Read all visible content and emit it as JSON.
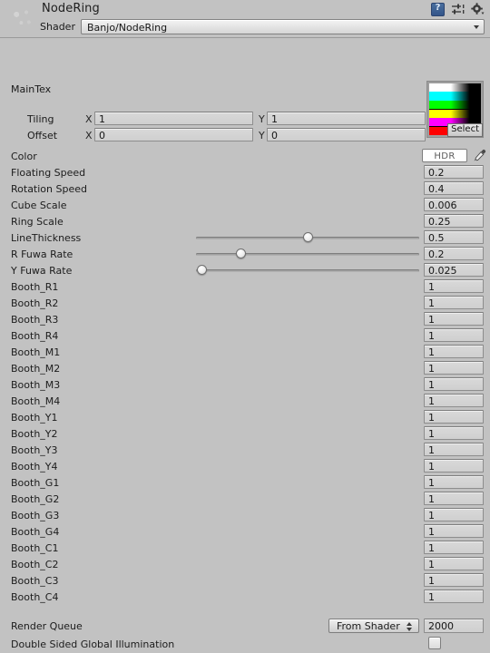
{
  "window": {
    "title": "NodeRing",
    "material_icon_name": "material-sphere-icon"
  },
  "header": {
    "icons": [
      {
        "name": "help-icon",
        "label": "?"
      },
      {
        "name": "preset-icon",
        "label": ""
      },
      {
        "name": "gear-icon",
        "label": ""
      }
    ],
    "shader": {
      "label": "Shader",
      "value": "Banjo/NodeRing"
    }
  },
  "main_texture": {
    "label": "MainTex",
    "select_button": "Select",
    "preview_bars": [
      "#ffffff",
      "#00ffff",
      "#00ff00",
      "#ffff00",
      "#ff00ff",
      "#ff0000"
    ],
    "tiling": {
      "label": "Tiling",
      "x_axis": "X",
      "x_value": "1",
      "y_axis": "Y",
      "y_value": "1"
    },
    "offset": {
      "label": "Offset",
      "x_axis": "X",
      "x_value": "0",
      "y_axis": "Y",
      "y_value": "0"
    }
  },
  "color_property": {
    "label": "Color",
    "hdr_label": "HDR",
    "swatch_color": "#ffffff",
    "eyedropper_name": "eyedropper-icon"
  },
  "properties": [
    {
      "label": "Floating Speed",
      "value": "0.2",
      "type": "number"
    },
    {
      "label": "Rotation Speed",
      "value": "0.4",
      "type": "number"
    },
    {
      "label": "Cube Scale",
      "value": "0.006",
      "type": "number"
    },
    {
      "label": "Ring Scale",
      "value": "0.25",
      "type": "number"
    },
    {
      "label": "LineThickness",
      "value": "0.5",
      "type": "slider",
      "fraction": 0.5
    },
    {
      "label": "R Fuwa Rate",
      "value": "0.2",
      "type": "slider",
      "fraction": 0.2
    },
    {
      "label": "Y Fuwa Rate",
      "value": "0.025",
      "type": "slider",
      "fraction": 0.025
    },
    {
      "label": "Booth_R1",
      "value": "1",
      "type": "number"
    },
    {
      "label": "Booth_R2",
      "value": "1",
      "type": "number"
    },
    {
      "label": "Booth_R3",
      "value": "1",
      "type": "number"
    },
    {
      "label": "Booth_R4",
      "value": "1",
      "type": "number"
    },
    {
      "label": "Booth_M1",
      "value": "1",
      "type": "number"
    },
    {
      "label": "Booth_M2",
      "value": "1",
      "type": "number"
    },
    {
      "label": "Booth_M3",
      "value": "1",
      "type": "number"
    },
    {
      "label": "Booth_M4",
      "value": "1",
      "type": "number"
    },
    {
      "label": "Booth_Y1",
      "value": "1",
      "type": "number"
    },
    {
      "label": "Booth_Y2",
      "value": "1",
      "type": "number"
    },
    {
      "label": "Booth_Y3",
      "value": "1",
      "type": "number"
    },
    {
      "label": "Booth_Y4",
      "value": "1",
      "type": "number"
    },
    {
      "label": "Booth_G1",
      "value": "1",
      "type": "number"
    },
    {
      "label": "Booth_G2",
      "value": "1",
      "type": "number"
    },
    {
      "label": "Booth_G3",
      "value": "1",
      "type": "number"
    },
    {
      "label": "Booth_G4",
      "value": "1",
      "type": "number"
    },
    {
      "label": "Booth_C1",
      "value": "1",
      "type": "number"
    },
    {
      "label": "Booth_C2",
      "value": "1",
      "type": "number"
    },
    {
      "label": "Booth_C3",
      "value": "1",
      "type": "number"
    },
    {
      "label": "Booth_C4",
      "value": "1",
      "type": "number"
    }
  ],
  "footer": {
    "render_queue": {
      "label": "Render Queue",
      "mode": "From Shader",
      "value": "2000"
    },
    "double_sided_gi": {
      "label": "Double Sided Global Illumination",
      "checked": false
    }
  }
}
